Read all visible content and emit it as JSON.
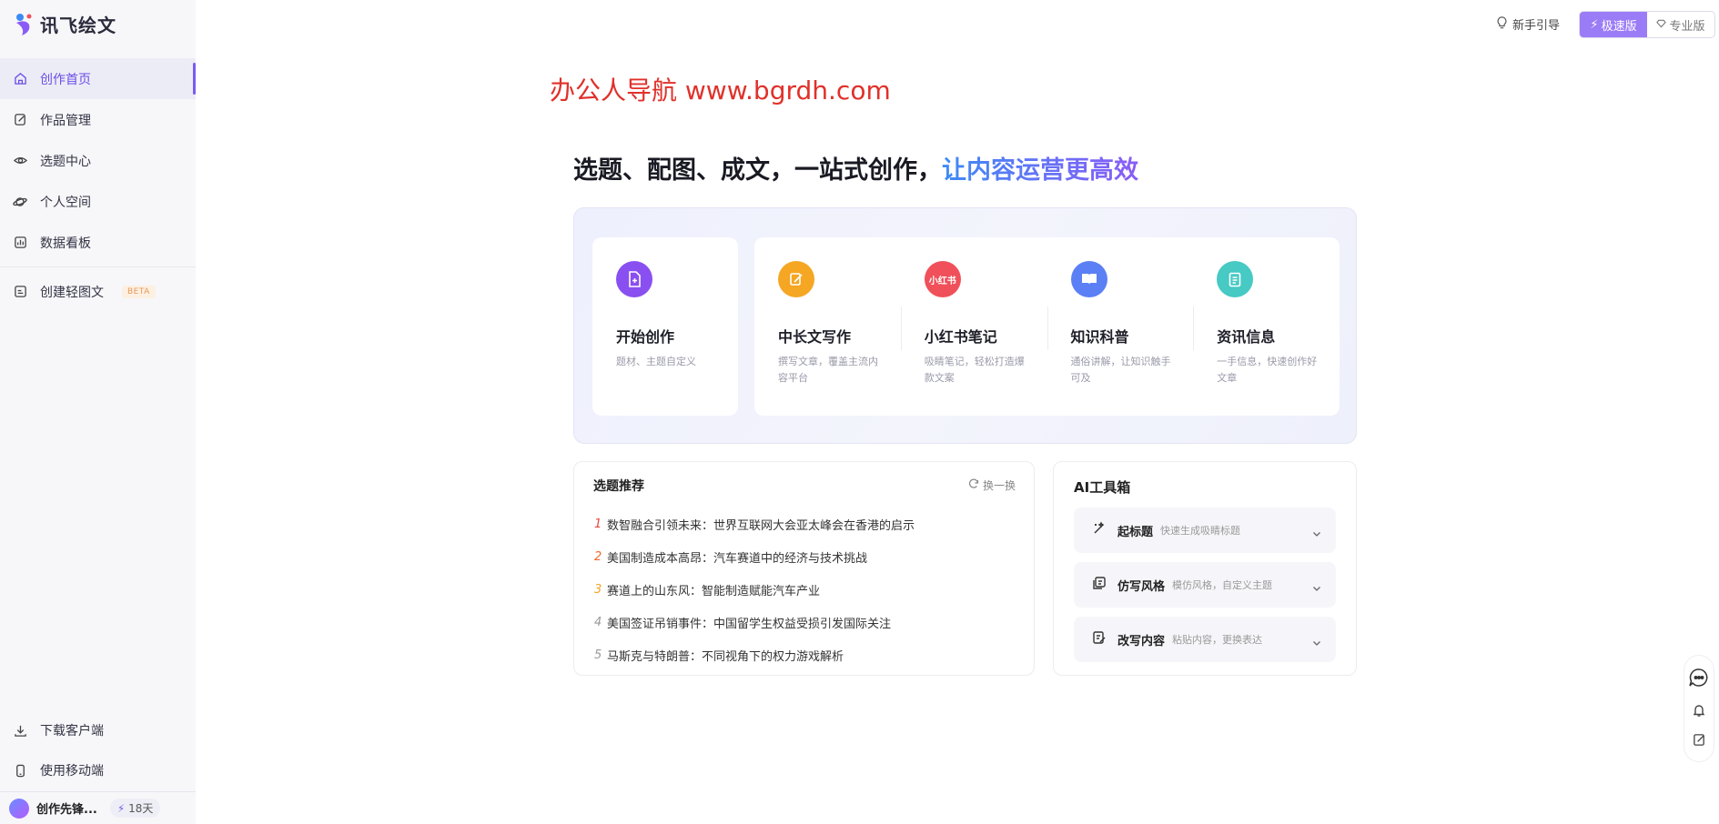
{
  "app": {
    "logo_text": "讯飞绘文"
  },
  "sidebar": {
    "items": [
      {
        "label": "创作首页",
        "icon": "home-icon",
        "active": true
      },
      {
        "label": "作品管理",
        "icon": "edit-icon"
      },
      {
        "label": "选题中心",
        "icon": "eye-icon"
      },
      {
        "label": "个人空间",
        "icon": "planet-icon"
      },
      {
        "label": "数据看板",
        "icon": "chart-icon"
      }
    ],
    "extra": {
      "label": "创建轻图文",
      "badge": "BETA",
      "icon": "image-doc-icon"
    },
    "bottom": [
      {
        "label": "下载客户端",
        "icon": "download-icon"
      },
      {
        "label": "使用移动端",
        "icon": "mobile-icon"
      }
    ],
    "user": {
      "name": "创作先锋...",
      "days": "18天"
    }
  },
  "header": {
    "guide_label": "新手引导",
    "modes": [
      {
        "label": "极速版",
        "active": true
      },
      {
        "label": "专业版"
      }
    ]
  },
  "watermark": "办公人导航 www.bgrdh.com",
  "headline": {
    "prefix": "选题、配图、成文，一站式创作，",
    "highlight": "让内容运营更高效"
  },
  "create": {
    "start": {
      "title": "开始创作",
      "desc": "题材、主题自定义",
      "color": "#8a4ff0"
    },
    "cards": [
      {
        "title": "中长文写作",
        "desc": "撰写文章，覆盖主流内容平台",
        "color": "#f5a623"
      },
      {
        "title": "小红书笔记",
        "desc": "吸睛笔记，轻松打造爆款文案",
        "color": "#f0505a",
        "icon_text": "小红书"
      },
      {
        "title": "知识科普",
        "desc": "通俗讲解，让知识触手可及",
        "color": "#5b7ff5"
      },
      {
        "title": "资讯信息",
        "desc": "一手信息，快速创作好文章",
        "color": "#47c9c4"
      }
    ]
  },
  "topics": {
    "title": "选题推荐",
    "refresh_label": "换一换",
    "items": [
      {
        "num": "1",
        "text": "数智融合引领未来：世界互联网大会亚太峰会在香港的启示",
        "color": "#e8453c"
      },
      {
        "num": "2",
        "text": "美国制造成本高昂：汽车赛道中的经济与技术挑战",
        "color": "#f06a2c"
      },
      {
        "num": "3",
        "text": "赛道上的山东风：智能制造赋能汽车产业",
        "color": "#f5a623"
      },
      {
        "num": "4",
        "text": "美国签证吊销事件：中国留学生权益受损引发国际关注",
        "color": "#999999"
      },
      {
        "num": "5",
        "text": "马斯克与特朗普：不同视角下的权力游戏解析",
        "color": "#999999"
      }
    ]
  },
  "toolbox": {
    "title": "AI工具箱",
    "tools": [
      {
        "name": "起标题",
        "desc": "快速生成吸睛标题",
        "icon": "magic-wand-icon"
      },
      {
        "name": "仿写风格",
        "desc": "模仿风格，自定义主题",
        "icon": "copy-style-icon"
      },
      {
        "name": "改写内容",
        "desc": "粘贴内容，更换表达",
        "icon": "rewrite-icon"
      }
    ]
  }
}
